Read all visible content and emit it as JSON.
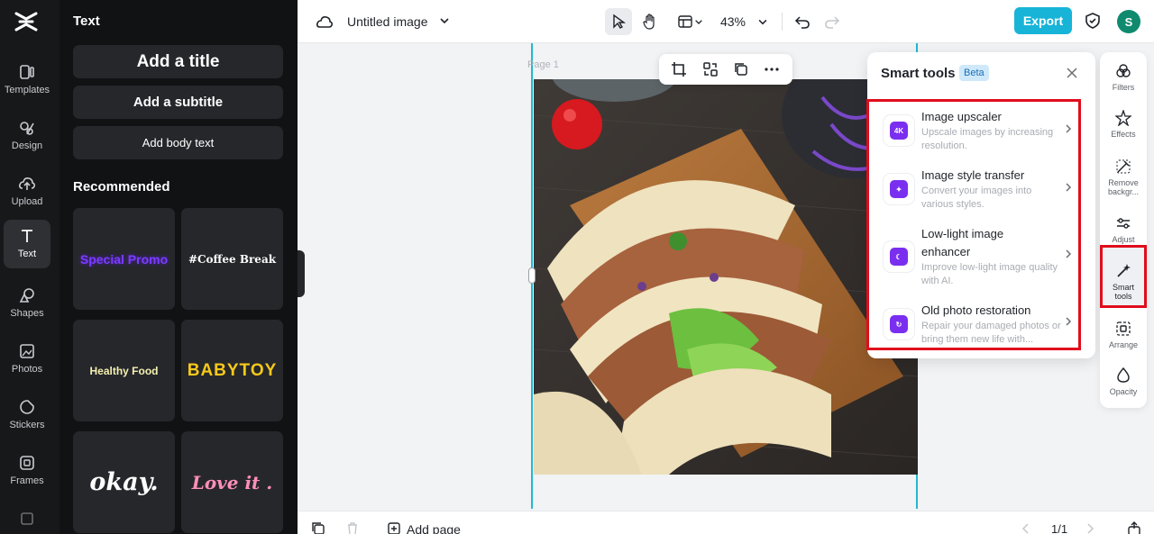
{
  "left_rail": {
    "items": [
      {
        "label": "Templates",
        "icon": "templates-icon"
      },
      {
        "label": "Design",
        "icon": "design-icon"
      },
      {
        "label": "Upload",
        "icon": "upload-cloud-icon"
      },
      {
        "label": "Text",
        "icon": "text-icon",
        "active": true
      },
      {
        "label": "Shapes",
        "icon": "shapes-icon"
      },
      {
        "label": "Photos",
        "icon": "photos-icon"
      },
      {
        "label": "Stickers",
        "icon": "stickers-icon"
      },
      {
        "label": "Frames",
        "icon": "frames-icon"
      }
    ]
  },
  "text_panel": {
    "title": "Text",
    "add_title": "Add a title",
    "add_subtitle": "Add a subtitle",
    "add_body": "Add body text",
    "recommended_title": "Recommended",
    "presets": [
      "Special Promo",
      "#Coffee Break",
      "Healthy Food",
      "BABYTOY",
      "okay.",
      "Love it ."
    ]
  },
  "topbar": {
    "doc_title": "Untitled image",
    "zoom": "43%",
    "export_label": "Export",
    "avatar_initial": "S"
  },
  "canvas": {
    "page_label": "Page 1"
  },
  "smart_tools": {
    "title": "Smart tools",
    "badge": "Beta",
    "items": [
      {
        "name": "Image upscaler",
        "desc": "Upscale images by increasing resolution.",
        "icon_text": "4K"
      },
      {
        "name": "Image style transfer",
        "desc": "Convert your images into various styles.",
        "icon_text": "✦"
      },
      {
        "name": "Low-light image enhancer",
        "desc": "Improve low-light image quality with AI.",
        "icon_text": "☾"
      },
      {
        "name": "Old photo restoration",
        "desc": "Repair your damaged photos or bring them new life with...",
        "icon_text": "↻"
      }
    ]
  },
  "right_rail": {
    "items": [
      {
        "label": "Filters"
      },
      {
        "label": "Effects"
      },
      {
        "label": "Remove backgr..."
      },
      {
        "label": "Adjust"
      },
      {
        "label": "Smart tools",
        "active": true
      },
      {
        "label": "Arrange"
      },
      {
        "label": "Opacity"
      }
    ]
  },
  "bottombar": {
    "add_page": "Add page",
    "pager": "1/1"
  },
  "colors": {
    "accent": "#18b4d8",
    "highlight": "#e00d1c",
    "smart_icon": "#7a2ff0"
  }
}
